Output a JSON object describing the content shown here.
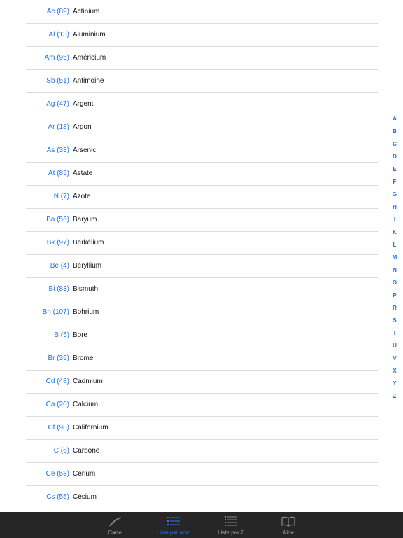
{
  "elements": [
    {
      "symbol": "Ac (89)",
      "name": "Actinium"
    },
    {
      "symbol": "Al (13)",
      "name": "Aluminium"
    },
    {
      "symbol": "Am (95)",
      "name": "Américium"
    },
    {
      "symbol": "Sb (51)",
      "name": "Antimoine"
    },
    {
      "symbol": "Ag (47)",
      "name": "Argent"
    },
    {
      "symbol": "Ar (18)",
      "name": "Argon"
    },
    {
      "symbol": "As (33)",
      "name": "Arsenic"
    },
    {
      "symbol": "At (85)",
      "name": "Astate"
    },
    {
      "symbol": "N (7)",
      "name": "Azote"
    },
    {
      "symbol": "Ba (56)",
      "name": "Baryum"
    },
    {
      "symbol": "Bk (97)",
      "name": "Berkélium"
    },
    {
      "symbol": "Be (4)",
      "name": "Béryllium"
    },
    {
      "symbol": "Bi (83)",
      "name": "Bismuth"
    },
    {
      "symbol": "Bh (107)",
      "name": "Bohrium"
    },
    {
      "symbol": "B (5)",
      "name": "Bore"
    },
    {
      "symbol": "Br (35)",
      "name": "Brome"
    },
    {
      "symbol": "Cd (48)",
      "name": "Cadmium"
    },
    {
      "symbol": "Ca (20)",
      "name": "Calcium"
    },
    {
      "symbol": "Cf (98)",
      "name": "Californium"
    },
    {
      "symbol": "C (6)",
      "name": "Carbone"
    },
    {
      "symbol": "Ce (58)",
      "name": "Cérium"
    },
    {
      "symbol": "Cs (55)",
      "name": "Césium"
    }
  ],
  "index_letters": [
    "A",
    "B",
    "C",
    "D",
    "E",
    "F",
    "G",
    "H",
    "I",
    "K",
    "L",
    "M",
    "N",
    "O",
    "P",
    "R",
    "S",
    "T",
    "U",
    "V",
    "X",
    "Y",
    "Z"
  ],
  "tabs": [
    {
      "label": "Carte",
      "icon": "pen-icon",
      "active": false
    },
    {
      "label": "Liste par nom",
      "icon": "list-icon",
      "active": true
    },
    {
      "label": "Liste par Z",
      "icon": "numbered-list-icon",
      "active": false
    },
    {
      "label": "Aide",
      "icon": "book-icon",
      "active": false
    }
  ],
  "colors": {
    "accent": "#1a73e8",
    "tab_active": "#2a7cf2",
    "tab_inactive": "#a8a8a8",
    "tabbar_bg": "#262626"
  }
}
